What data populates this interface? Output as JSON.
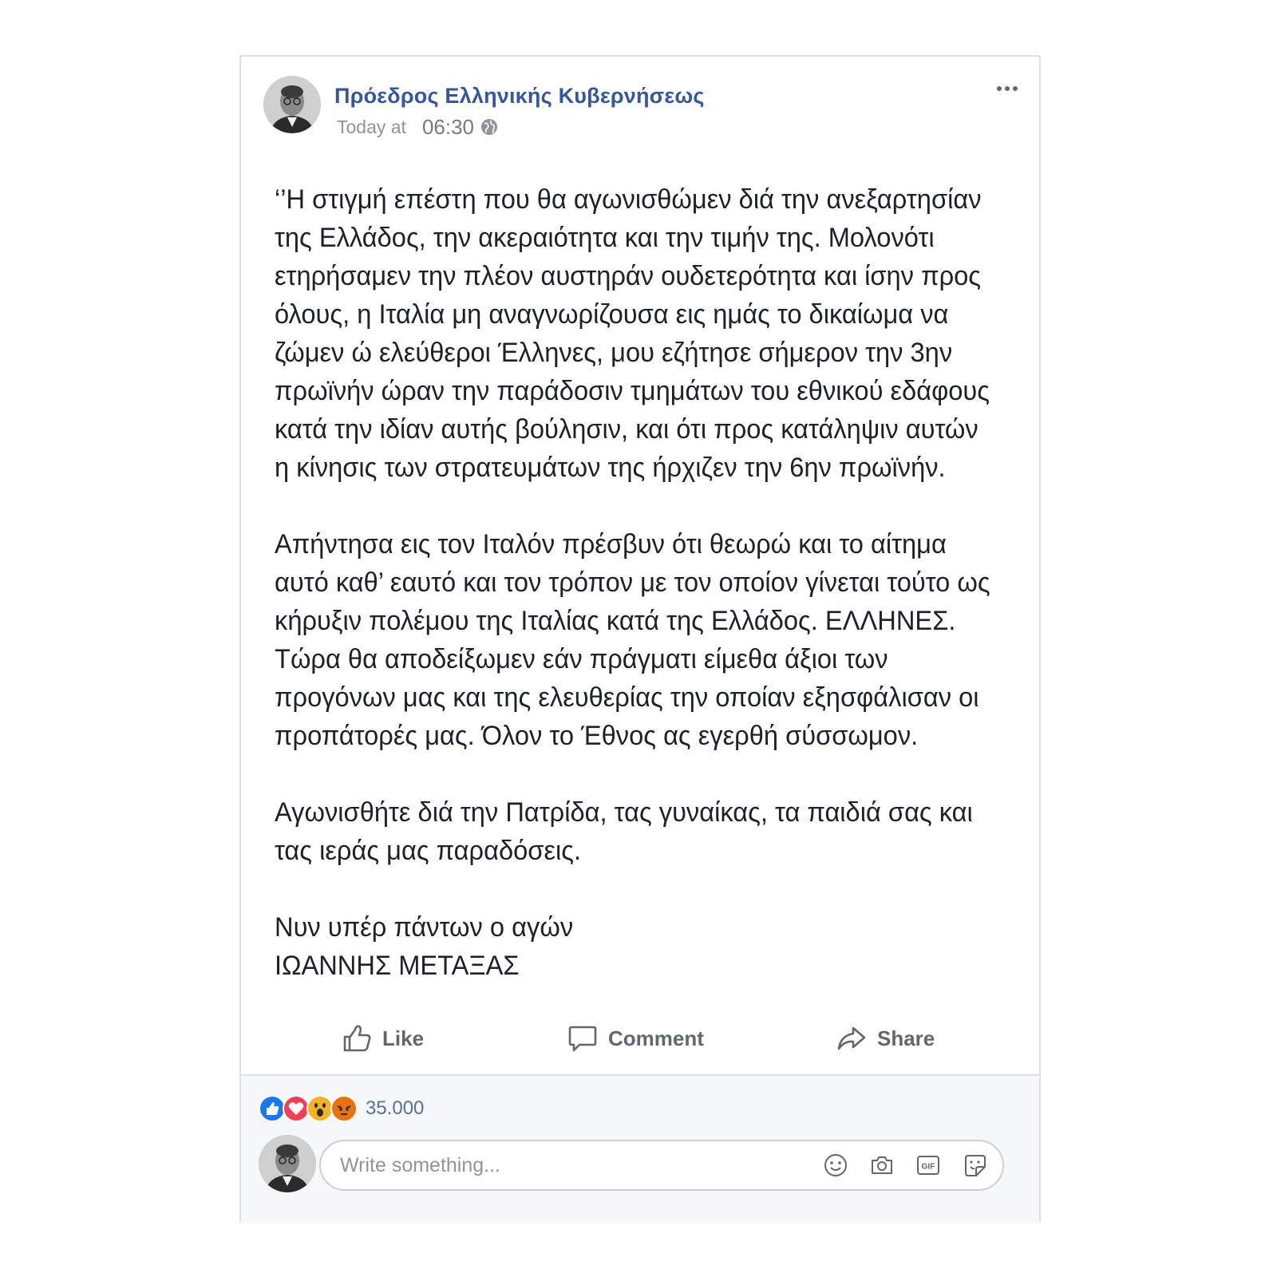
{
  "post": {
    "author": "Πρόεδρος Ελληνικής Κυβερνήσεως",
    "timestamp_prefix": "Today at",
    "timestamp_time": "06:30",
    "paragraphs": [
      "‘’Η στιγμή επέστη που θα αγωνισθώμεν διά την ανεξαρτησίαν της Ελλάδος, την ακεραιότητα και την τιμήν της. Μολονότι ετηρήσαμεν την πλέον αυστηράν ουδετερότητα και ίσην προς όλους, η Ιταλία μη αναγνωρίζουσα εις ημάς το δικαίωμα να ζώμεν ώ ελεύθεροι Έλληνες, μου εζήτησε σήμερον την 3ην πρωϊνήν ώραν την παράδοσιν τμημάτων του εθνικού εδάφους κατά την ιδίαν αυτής βούλησιν, και ότι προς κατάληψιν αυτών η κίνησις των στρατευμάτων της ήρχιζεν την 6ην πρωϊνήν.",
      "Απήντησα εις τον Ιταλόν πρέσβυν ότι θεωρώ και το αίτημα αυτό καθ’ εαυτό και τον τρόπον με τον οποίον γίνεται τούτο ως κήρυξιν πολέμου της Ιταλίας κατά της Ελλάδος. ΕΛΛΗΝΕΣ. Τώρα θα αποδείξωμεν εάν πράγματι είμεθα άξιοι των προγόνων μας και της ελευθερίας την οποίαν εξησφάλισαν οι προπάτορές μας. Όλον το Έθνος ας εγερθή σύσσωμον.",
      "Αγωνισθήτε διά την Πατρίδα, τας γυναίκας, τα παιδιά σας και τας ιεράς μας παραδόσεις."
    ],
    "signature_line1": "Νυν υπέρ πάντων ο αγών",
    "signature_line2": "ΙΩΑΝΝΗΣ ΜΕΤΑΞΑΣ"
  },
  "actions": {
    "like": "Like",
    "comment": "Comment",
    "share": "Share"
  },
  "reactions": {
    "count": "35.000",
    "types": [
      "like",
      "love",
      "wow",
      "angry"
    ]
  },
  "comment_box": {
    "placeholder": "Write something...",
    "tools": [
      "emoji-icon",
      "camera-icon",
      "gif-icon",
      "sticker-icon"
    ]
  },
  "colors": {
    "author": "#365899",
    "like_blue": "#1877f2",
    "love_red": "#f33e58",
    "wow_yellow": "#f7b125",
    "angry_orange": "#e9710f"
  }
}
